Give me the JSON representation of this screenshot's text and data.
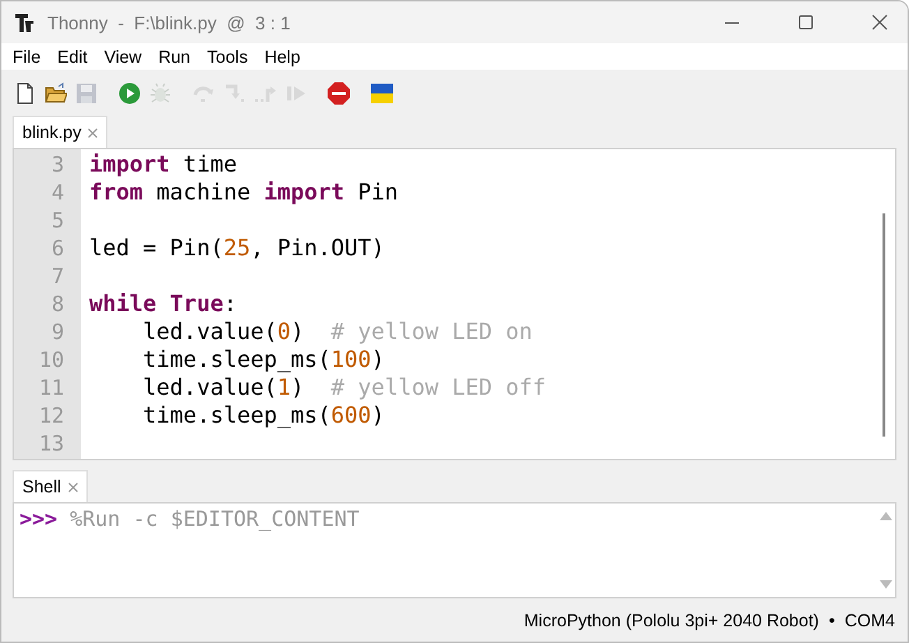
{
  "window": {
    "title": "Thonny  -  F:\\blink.py  @  3 : 1"
  },
  "menu": [
    "File",
    "Edit",
    "View",
    "Run",
    "Tools",
    "Help"
  ],
  "toolbar": [
    [
      {
        "kind": "new",
        "disabled": false
      },
      {
        "kind": "open",
        "disabled": false
      },
      {
        "kind": "save",
        "disabled": true
      }
    ],
    [
      {
        "kind": "run",
        "disabled": false
      },
      {
        "kind": "debug",
        "disabled": true
      }
    ],
    [
      {
        "kind": "step-over",
        "disabled": true
      },
      {
        "kind": "step-into",
        "disabled": true
      },
      {
        "kind": "step-out",
        "disabled": true
      },
      {
        "kind": "resume",
        "disabled": true
      }
    ],
    [
      {
        "kind": "stop",
        "disabled": false
      }
    ],
    [
      {
        "kind": "flag",
        "disabled": false
      }
    ]
  ],
  "editor": {
    "tabs": [
      {
        "label": "blink.py",
        "selected": true
      }
    ],
    "lines": [
      {
        "number": "3",
        "tokens": [
          {
            "kind": "keyword",
            "text": "import"
          },
          {
            "kind": "plain",
            "text": " time"
          }
        ]
      },
      {
        "number": "4",
        "tokens": [
          {
            "kind": "keyword",
            "text": "from"
          },
          {
            "kind": "plain",
            "text": " machine "
          },
          {
            "kind": "keyword",
            "text": "import"
          },
          {
            "kind": "plain",
            "text": " Pin"
          }
        ]
      },
      {
        "number": "5"
      },
      {
        "number": "6",
        "tokens": [
          {
            "kind": "plain",
            "text": "led = Pin("
          },
          {
            "kind": "number",
            "text": "25"
          },
          {
            "kind": "plain",
            "text": ", Pin.OUT)"
          }
        ]
      },
      {
        "number": "7"
      },
      {
        "number": "8",
        "tokens": [
          {
            "kind": "keyword",
            "text": "while True"
          },
          {
            "kind": "plain",
            "text": ":"
          }
        ]
      },
      {
        "number": "9",
        "tokens": [
          {
            "kind": "plain",
            "text": "    led.value("
          },
          {
            "kind": "number",
            "text": "0"
          },
          {
            "kind": "plain",
            "text": ")  "
          },
          {
            "kind": "comment",
            "text": "# yellow LED on"
          }
        ]
      },
      {
        "number": "10",
        "tokens": [
          {
            "kind": "plain",
            "text": "    time.sleep_ms("
          },
          {
            "kind": "number",
            "text": "100"
          },
          {
            "kind": "plain",
            "text": ")"
          }
        ]
      },
      {
        "number": "11",
        "tokens": [
          {
            "kind": "plain",
            "text": "    led.value("
          },
          {
            "kind": "number",
            "text": "1"
          },
          {
            "kind": "plain",
            "text": ")  "
          },
          {
            "kind": "comment",
            "text": "# yellow LED off"
          }
        ]
      },
      {
        "number": "12",
        "tokens": [
          {
            "kind": "plain",
            "text": "    time.sleep_ms("
          },
          {
            "kind": "number",
            "text": "600"
          },
          {
            "kind": "plain",
            "text": ")"
          }
        ]
      },
      {
        "number": "13"
      }
    ]
  },
  "shell": {
    "tabs": [
      {
        "label": "Shell",
        "selected": true
      }
    ],
    "prompt": ">>>",
    "command": "%Run -c $EDITOR_CONTENT"
  },
  "status_bar": {
    "interpreter": "MicroPython (Pololu 3pi+ 2040 Robot)",
    "separator": "•",
    "port": "COM4"
  }
}
